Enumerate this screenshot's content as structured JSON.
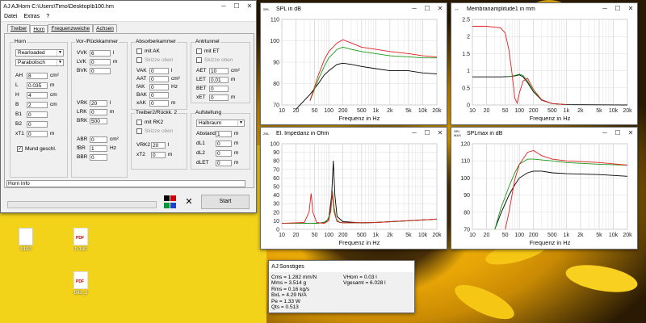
{
  "desktop": {
    "icons": [
      {
        "name": "file-icon",
        "kind": "file",
        "label": "b100"
      },
      {
        "name": "pdf-icon-1",
        "kind": "pdf",
        "label": "b 100"
      },
      {
        "name": "pdf-icon-2",
        "kind": "pdf",
        "label": "Bild_2"
      }
    ],
    "pdf_badge": "PDF"
  },
  "main": {
    "title": "AJHorn  C:\\Users\\Timo\\Desktop\\b100.hrn",
    "icon": "AJ",
    "controls": {
      "minimize": "─",
      "maximize": "☐",
      "close": "✕"
    },
    "menu": [
      "Datei",
      "Extras",
      "?"
    ],
    "tabs": [
      "Treiber",
      "Horn",
      "Frequenzweiche",
      "Achsen"
    ],
    "horn": {
      "label": "Horn",
      "type": "Rearloaded",
      "profile": "Parabolisch",
      "fields": [
        {
          "label": "AH",
          "value": "8",
          "unit": "cm²"
        },
        {
          "label": "L",
          "value": "0.035",
          "unit": "m"
        },
        {
          "label": "H",
          "value": "4",
          "unit": "cm"
        },
        {
          "label": "B",
          "value": "2",
          "unit": "cm"
        },
        {
          "label": "B1",
          "value": "0",
          "unit": ""
        },
        {
          "label": "B2",
          "value": "0",
          "unit": ""
        },
        {
          "label": "xT1",
          "value": "0",
          "unit": "m"
        }
      ],
      "mund_label": "Mund geschl.",
      "mund_checked": true
    },
    "vor": {
      "label": "Vor-/Rückkammer",
      "fields_top": [
        {
          "label": "VVK",
          "value": "6",
          "unit": "l"
        },
        {
          "label": "LVK",
          "value": "0",
          "unit": "m"
        },
        {
          "label": "BVK",
          "value": "0",
          "unit": ""
        }
      ],
      "fields_mid": [
        {
          "label": "VRK",
          "value": "20",
          "unit": "l"
        },
        {
          "label": "LRK",
          "value": "0",
          "unit": "m"
        },
        {
          "label": "BRK",
          "value": "500",
          "unit": ""
        }
      ],
      "fields_bot": [
        {
          "label": "ABR",
          "value": "0",
          "unit": "cm²"
        },
        {
          "label": "fBR",
          "value": "1",
          "unit": "Hz"
        },
        {
          "label": "BBR",
          "value": "0",
          "unit": ""
        }
      ]
    },
    "absorber": {
      "label": "Absorberkammer",
      "mit": "mit AK",
      "skizze": "Skizze oben",
      "fields": [
        {
          "label": "VAK",
          "value": "0",
          "unit": "l"
        },
        {
          "label": "AAT",
          "value": "0",
          "unit": "cm²"
        },
        {
          "label": "fAK",
          "value": "0",
          "unit": "Hz"
        },
        {
          "label": "BAK",
          "value": "0",
          "unit": ""
        },
        {
          "label": "xAK",
          "value": "0",
          "unit": "m"
        }
      ]
    },
    "treiber2": {
      "label": "Treiber2/Rückk. 2",
      "mit": "mit RK2",
      "skizze": "Skizze oben",
      "fields": [
        {
          "label": "VRK2",
          "value": "20",
          "unit": "l"
        },
        {
          "label": "xT2",
          "value": "0",
          "unit": "m"
        }
      ]
    },
    "tunnel": {
      "label": "Antrtunnel",
      "mit": "mit ET",
      "skizze": "Skizze oben",
      "fields": [
        {
          "label": "AET",
          "value": "10",
          "unit": "cm²"
        },
        {
          "label": "LET",
          "value": "0.01",
          "unit": "m"
        },
        {
          "label": "BET",
          "value": "0",
          "unit": ""
        },
        {
          "label": "xET",
          "value": "0",
          "unit": "m"
        }
      ]
    },
    "aufstellung": {
      "label": "Aufstellung",
      "value": "Halbraum",
      "fields": [
        {
          "label": "Abstand",
          "value": "1",
          "unit": "m"
        },
        {
          "label": "dL1",
          "value": "0",
          "unit": "m"
        },
        {
          "label": "dL2",
          "value": "0",
          "unit": "m"
        },
        {
          "label": "dLET",
          "value": "0",
          "unit": "m"
        }
      ]
    },
    "horn_info": "Horn Info",
    "start": "Start",
    "close_x": "✕",
    "color_squares": [
      "#000000",
      "#cc0000",
      "#009933",
      "#1a44cc"
    ]
  },
  "spl": {
    "title": "SPL in dB",
    "icon": "SPL"
  },
  "membran": {
    "title": "Membranamplitude1 in mm",
    "icon": "↔"
  },
  "imp": {
    "title": "El. Impedanz in Ohm",
    "icon": "ZEL"
  },
  "splmax": {
    "title": "SPLmax in dB",
    "icon": "SPL MAX"
  },
  "freq_label": "Frequenz in Hz",
  "series_colors": {
    "black": "#000000",
    "red": "#e02020",
    "green": "#1a9a1a"
  },
  "sonstiges": {
    "title": "Sonstiges",
    "icon": "AJ",
    "left": [
      "Cms = 1.282 mm/N",
      "Mms = 3.514 g",
      "Rms = 0.16 kg/s",
      "BxL = 4.29 N/A",
      "Pe = 1.33 W",
      "Qts = 0.513"
    ],
    "right": [
      "VHorn = 0.03 l",
      "Vgesamt = 6.028 l"
    ]
  },
  "chart_data": [
    {
      "type": "line",
      "title": "SPL in dB",
      "xlabel": "Frequenz in Hz",
      "ylabel": "",
      "xscale": "log",
      "xlim": [
        10,
        20000
      ],
      "ylim": [
        70,
        110
      ],
      "xticks": [
        "10",
        "20",
        "50",
        "100",
        "200",
        "500",
        "1k",
        "2k",
        "5k",
        "10k",
        "20k"
      ],
      "yticks": [
        "70",
        "80",
        "90",
        "100",
        "110"
      ],
      "series": [
        {
          "color": "black",
          "x": [
            20,
            40,
            60,
            80,
            100,
            150,
            200,
            300,
            500,
            1000,
            2000,
            5000,
            10000,
            20000
          ],
          "y": [
            68,
            75,
            80,
            84,
            86,
            89,
            89.5,
            89,
            88,
            87,
            86,
            86,
            85,
            84.5
          ]
        },
        {
          "color": "green",
          "x": [
            40,
            60,
            80,
            100,
            150,
            200,
            300,
            500,
            1000,
            2000,
            5000,
            10000,
            20000
          ],
          "y": [
            72,
            82,
            88,
            92,
            96,
            97,
            96,
            95,
            94,
            93,
            92.5,
            92,
            92
          ]
        },
        {
          "color": "red",
          "x": [
            40,
            60,
            80,
            100,
            150,
            200,
            300,
            500,
            1000,
            2000,
            5000,
            10000,
            20000
          ],
          "y": [
            72,
            84,
            91,
            95,
            99,
            100.5,
            99,
            97,
            96,
            95,
            94,
            93,
            92.5
          ]
        }
      ]
    },
    {
      "type": "line",
      "title": "Membranamplitude1 in mm",
      "xlabel": "Frequenz in Hz",
      "ylabel": "",
      "xscale": "log",
      "xlim": [
        10,
        20000
      ],
      "ylim": [
        0,
        2.5
      ],
      "xticks": [
        "10",
        "20",
        "50",
        "100",
        "200",
        "500",
        "1k",
        "2k",
        "5k",
        "10k",
        "20k"
      ],
      "yticks": [
        "0",
        "0.5",
        "1",
        "1.5",
        "2",
        "2.5"
      ],
      "series": [
        {
          "color": "black",
          "x": [
            10,
            20,
            40,
            60,
            80,
            100,
            120,
            150,
            200,
            300,
            500,
            1000,
            20000
          ],
          "y": [
            0.82,
            0.82,
            0.82,
            0.83,
            0.85,
            0.88,
            0.82,
            0.65,
            0.38,
            0.14,
            0.04,
            0.01,
            0
          ]
        },
        {
          "color": "green",
          "x": [
            60,
            80,
            100,
            120,
            150,
            200,
            300,
            500,
            1000
          ],
          "y": [
            0.83,
            0.86,
            0.9,
            0.86,
            0.7,
            0.4,
            0.15,
            0.04,
            0.01
          ]
        },
        {
          "color": "red",
          "x": [
            10,
            20,
            40,
            50,
            60,
            70,
            80,
            90,
            100,
            120,
            150,
            200,
            300,
            500,
            1000
          ],
          "y": [
            2.3,
            2.3,
            2.25,
            2.1,
            1.6,
            0.9,
            0.2,
            0.05,
            0.35,
            0.7,
            0.78,
            0.45,
            0.15,
            0.04,
            0.01
          ]
        }
      ]
    },
    {
      "type": "line",
      "title": "El. Impedanz in Ohm",
      "xlabel": "Frequenz in Hz",
      "ylabel": "",
      "xscale": "log",
      "xlim": [
        10,
        20000
      ],
      "ylim": [
        0,
        100
      ],
      "xticks": [
        "10",
        "20",
        "50",
        "100",
        "200",
        "500",
        "1k",
        "2k",
        "5k",
        "10k",
        "20k"
      ],
      "yticks": [
        "0",
        "10",
        "20",
        "30",
        "40",
        "50",
        "60",
        "70",
        "80",
        "90",
        "100"
      ],
      "series": [
        {
          "color": "black",
          "x": [
            10,
            50,
            80,
            100,
            115,
            125,
            135,
            150,
            200,
            500,
            1000,
            5000,
            20000
          ],
          "y": [
            7,
            7,
            8,
            12,
            40,
            80,
            40,
            15,
            9,
            7.5,
            8,
            10,
            12
          ]
        },
        {
          "color": "green",
          "x": [
            10,
            60,
            90,
            110,
            120,
            130,
            145,
            170,
            250,
            1000,
            5000,
            20000
          ],
          "y": [
            7,
            7,
            9,
            20,
            45,
            25,
            12,
            8,
            7.5,
            8,
            10,
            12
          ]
        },
        {
          "color": "red",
          "x": [
            10,
            30,
            38,
            42,
            46,
            55,
            80,
            100,
            110,
            118,
            130,
            150,
            200,
            1000,
            20000
          ],
          "y": [
            7,
            8,
            20,
            42,
            20,
            8,
            7,
            10,
            25,
            43,
            20,
            9,
            7.5,
            8,
            12
          ]
        }
      ]
    },
    {
      "type": "line",
      "title": "SPLmax in dB",
      "xlabel": "Frequenz in Hz",
      "ylabel": "",
      "xscale": "log",
      "xlim": [
        10,
        20000
      ],
      "ylim": [
        70,
        120
      ],
      "xticks": [
        "10",
        "20",
        "50",
        "100",
        "200",
        "500",
        "1k",
        "2k",
        "5k",
        "10k",
        "20k"
      ],
      "yticks": [
        "70",
        "80",
        "90",
        "100",
        "110",
        "120"
      ],
      "series": [
        {
          "color": "black",
          "x": [
            30,
            40,
            60,
            80,
            100,
            150,
            200,
            300,
            500,
            1000,
            5000,
            20000
          ],
          "y": [
            70,
            79,
            90,
            96,
            100,
            103,
            104,
            104,
            103,
            102.5,
            102,
            101
          ]
        },
        {
          "color": "green",
          "x": [
            30,
            40,
            60,
            80,
            100,
            150,
            200,
            300,
            500,
            1000,
            5000,
            20000
          ],
          "y": [
            70,
            82,
            95,
            103,
            108,
            111,
            111,
            110.5,
            110,
            109,
            108,
            107.5
          ]
        },
        {
          "color": "red",
          "x": [
            50,
            60,
            80,
            100,
            150,
            200,
            300,
            500,
            1000,
            5000,
            20000
          ],
          "y": [
            70,
            80,
            99,
            108,
            115,
            116,
            113,
            111,
            110,
            109,
            107.5
          ]
        }
      ]
    }
  ]
}
